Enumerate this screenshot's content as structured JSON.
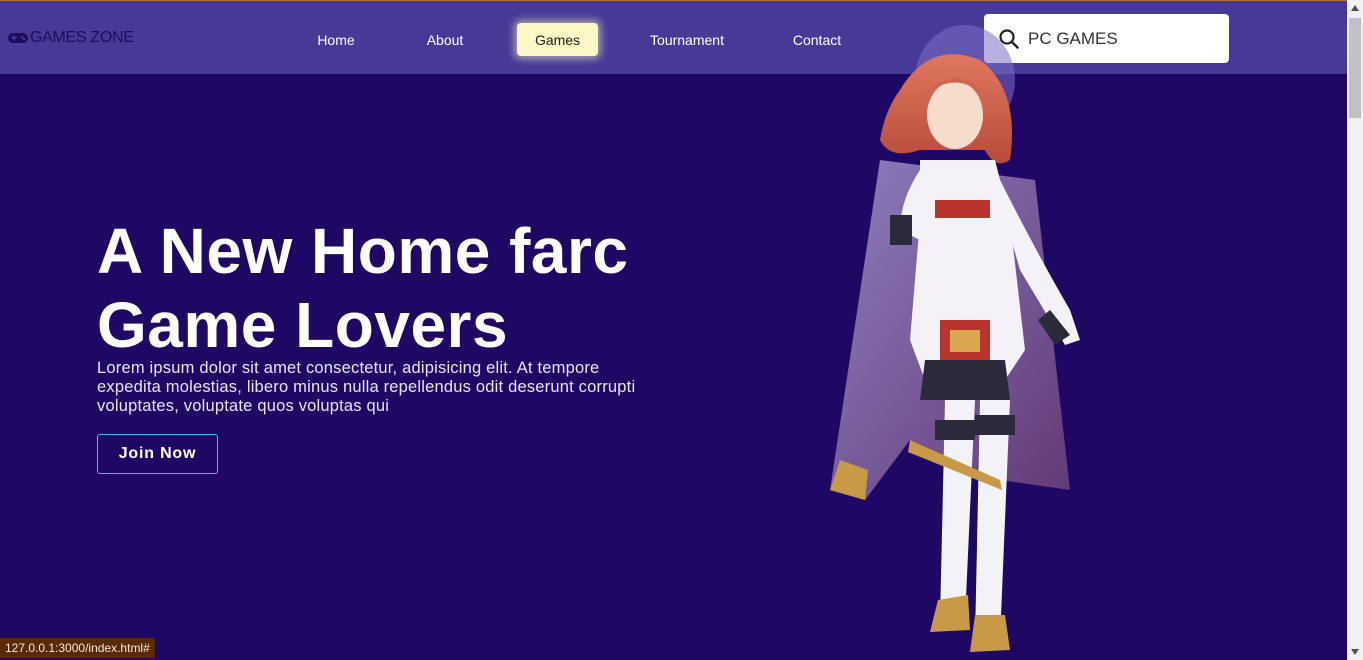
{
  "brand": {
    "logo_text": "GAMES ZONE",
    "logo_icon": "gamepad-icon"
  },
  "nav": {
    "items": [
      {
        "label": "Home"
      },
      {
        "label": "About"
      },
      {
        "label": "Games",
        "active": true
      },
      {
        "label": "Tournament"
      },
      {
        "label": "Contact"
      }
    ]
  },
  "search": {
    "value": "PC GAMES",
    "icon": "search-icon"
  },
  "hero": {
    "title": "A New Home farc Game Lovers",
    "description": "Lorem ipsum dolor sit amet consectetur, adipisicing elit. At tempore expedita molestias, libero minus nulla repellendus odit deserunt corrupti voluptates, voluptate quos voluptas qui",
    "cta_label": "Join Now"
  },
  "status_bar": {
    "url": "127.0.0.1:3000/index.html#"
  },
  "colors": {
    "background": "#1e0864",
    "navbar": "#463a96",
    "active_nav": "#fdf8c6",
    "button_border": "#40c0f0"
  }
}
